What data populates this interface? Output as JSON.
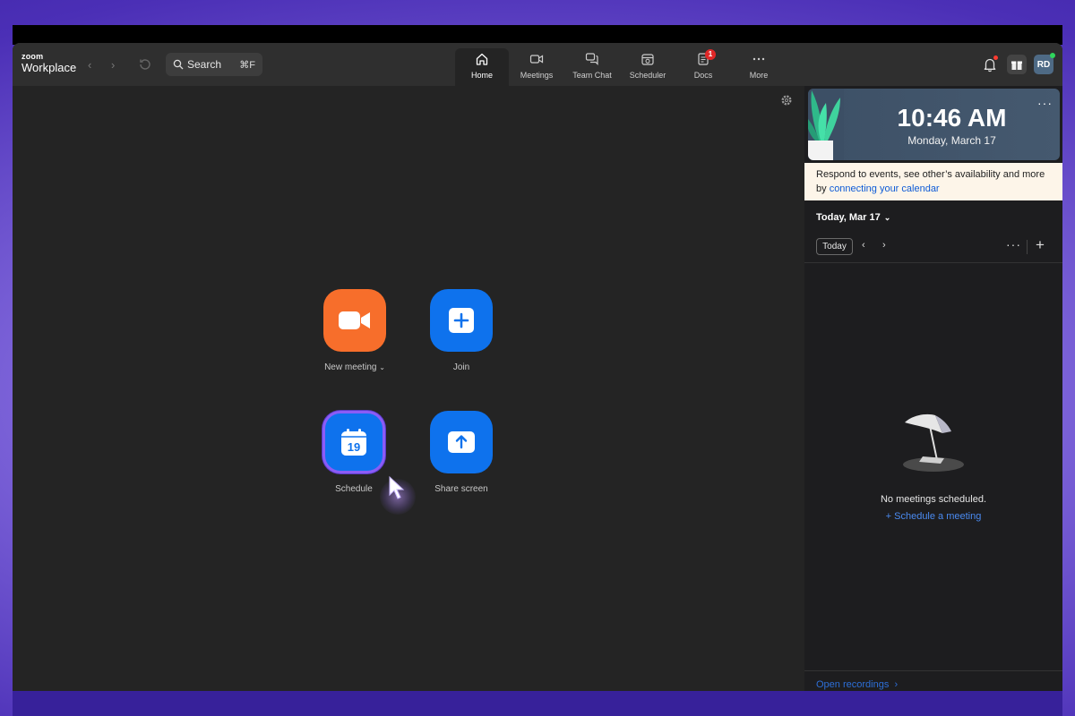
{
  "app": {
    "brand_small": "zoom",
    "brand_big": "Workplace"
  },
  "search": {
    "label": "Search",
    "shortcut": "⌘F"
  },
  "tabs": [
    {
      "label": "Home",
      "icon": "home-icon"
    },
    {
      "label": "Meetings",
      "icon": "video-icon"
    },
    {
      "label": "Team Chat",
      "icon": "chat-icon"
    },
    {
      "label": "Scheduler",
      "icon": "scheduler-icon"
    },
    {
      "label": "Docs",
      "icon": "docs-icon",
      "badge": "1"
    },
    {
      "label": "More",
      "icon": "more-icon"
    }
  ],
  "user": {
    "initials": "RD"
  },
  "actions": {
    "new_meeting": "New meeting",
    "join": "Join",
    "schedule": "Schedule",
    "schedule_day": "19",
    "share_screen": "Share screen"
  },
  "colors": {
    "orange": "#f76e2b",
    "blue": "#0e72ed",
    "link": "#4a8af0"
  },
  "calendar": {
    "time": "10:46 AM",
    "date": "Monday, March 17",
    "notice_text": "Respond to events, see other’s availability and more by",
    "notice_link": "connecting your calendar",
    "date_head": "Today, Mar 17",
    "today_button": "Today",
    "empty_text": "No meetings scheduled.",
    "schedule_link": "Schedule a meeting",
    "recordings_link": "Open recordings"
  }
}
